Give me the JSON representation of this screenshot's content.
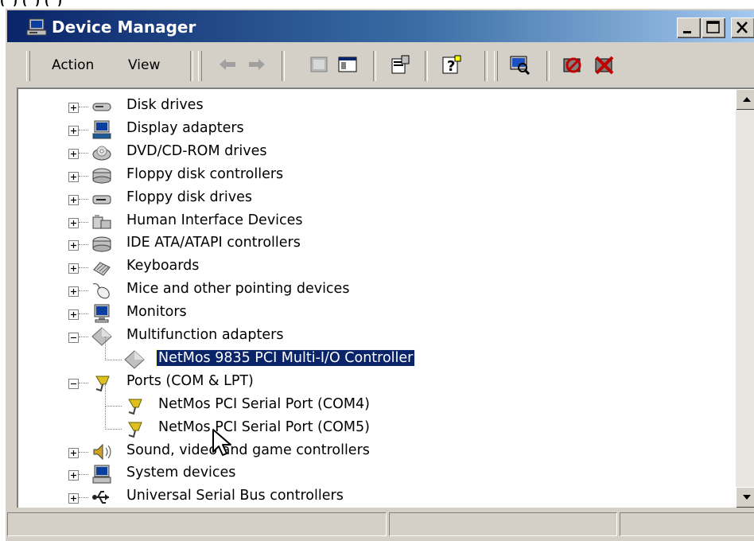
{
  "top_crop": "(   )   (   )              (               )",
  "window": {
    "title": "Device Manager",
    "controls": [
      "minimize",
      "maximize",
      "close"
    ]
  },
  "menu": {
    "action": "Action",
    "view": "View"
  },
  "toolbar": {
    "buttons": [
      "back-arrow-icon",
      "forward-arrow-icon",
      "up-folder-icon",
      "show-hide-tree-icon",
      "properties-icon",
      "help-icon",
      "scan-hardware-icon",
      "disable-device-icon",
      "uninstall-device-icon"
    ]
  },
  "tree": {
    "items": [
      {
        "label": "Disk drives",
        "icon": "disk-drive-icon",
        "state": "collapsed"
      },
      {
        "label": "Display adapters",
        "icon": "display-adapter-icon",
        "state": "collapsed"
      },
      {
        "label": "DVD/CD-ROM drives",
        "icon": "cdrom-icon",
        "state": "collapsed"
      },
      {
        "label": "Floppy disk controllers",
        "icon": "controller-icon",
        "state": "collapsed"
      },
      {
        "label": "Floppy disk drives",
        "icon": "floppy-drive-icon",
        "state": "collapsed"
      },
      {
        "label": "Human Interface Devices",
        "icon": "hid-icon",
        "state": "collapsed"
      },
      {
        "label": "IDE ATA/ATAPI controllers",
        "icon": "controller-icon",
        "state": "collapsed"
      },
      {
        "label": "Keyboards",
        "icon": "keyboard-icon",
        "state": "collapsed"
      },
      {
        "label": "Mice and other pointing devices",
        "icon": "mouse-icon",
        "state": "collapsed"
      },
      {
        "label": "Monitors",
        "icon": "monitor-icon",
        "state": "collapsed"
      },
      {
        "label": "Multifunction adapters",
        "icon": "multifunction-icon",
        "state": "expanded"
      },
      {
        "label": "NetMos 9835 PCI Multi-I/O Controller",
        "icon": "multifunction-icon",
        "state": "child",
        "selected": true
      },
      {
        "label": "Ports (COM & LPT)",
        "icon": "port-icon",
        "state": "expanded"
      },
      {
        "label": "NetMos PCI Serial Port (COM4)",
        "icon": "port-icon",
        "state": "child"
      },
      {
        "label": "NetMos PCI Serial Port (COM5)",
        "icon": "port-icon",
        "state": "child"
      },
      {
        "label": "Sound, video and game controllers",
        "icon": "sound-icon",
        "state": "collapsed"
      },
      {
        "label": "System devices",
        "icon": "system-icon",
        "state": "collapsed"
      },
      {
        "label": "Universal Serial Bus controllers",
        "icon": "usb-icon",
        "state": "collapsed"
      }
    ]
  },
  "colors": {
    "title_start": "#0a246a",
    "title_end": "#a6caf0",
    "selection": "#0a246a",
    "face": "#d4d0c8"
  }
}
